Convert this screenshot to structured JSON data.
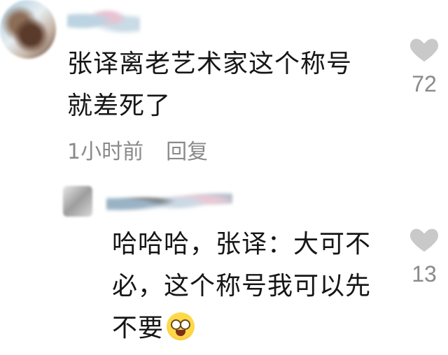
{
  "top_comment": {
    "text_line1": "张译离老艺术家这个称号",
    "text_line2": "就差死了",
    "time": "1小时前",
    "reply_label": "回复",
    "likes": "72"
  },
  "reply": {
    "text_line1": "哈哈哈，张译：大可不",
    "text_line2": "必，这个称号我可以先",
    "text_line3": "不要",
    "emoji": "laughing-tears-emoji",
    "likes": "13"
  },
  "icons": {
    "like": "heart-icon"
  },
  "colors": {
    "text": "#161616",
    "meta": "#8a8a8a",
    "heart": "#c9c9c9"
  }
}
